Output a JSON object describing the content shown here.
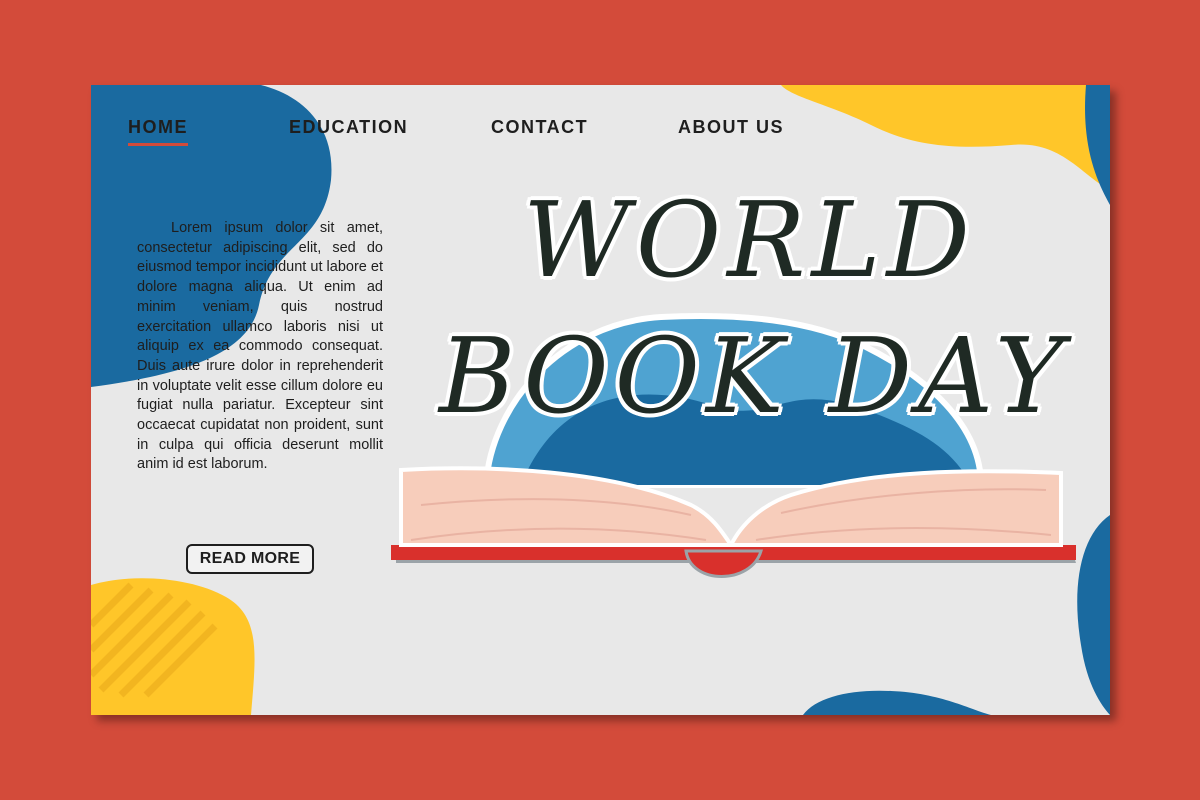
{
  "nav": {
    "items": [
      {
        "label": "HOME",
        "active": true
      },
      {
        "label": "EDUCATION",
        "active": false
      },
      {
        "label": "CONTACT",
        "active": false
      },
      {
        "label": "ABOUT US",
        "active": false
      }
    ]
  },
  "intro": {
    "body": "Lorem ipsum dolor sit amet, consectetur adipiscing elit, sed do eiusmod tempor incididunt ut labore et dolore magna aliqua. Ut enim ad minim veniam, quis nostrud exercitation ullamco laboris nisi ut aliquip ex ea commodo consequat. Duis aute irure dolor in reprehenderit in voluptate velit esse cillum dolore eu fugiat nulla pariatur. Excepteur sint occaecat cupidatat non proident, sunt in culpa qui officia deserunt mollit anim id est laborum.",
    "button_label": "READ MORE"
  },
  "hero": {
    "title_line1": "WORLD",
    "title_line2": "BOOK DAY"
  },
  "colors": {
    "background": "#D34B3A",
    "page": "#E8E8E8",
    "blue": "#1A6AA0",
    "light_blue": "#4FA3D1",
    "yellow": "#FFC629",
    "book_pages": "#F7CDBB",
    "book_cover": "#D9302C",
    "text": "#1F2A24"
  },
  "icons": {
    "book": "open-book-illustration"
  }
}
